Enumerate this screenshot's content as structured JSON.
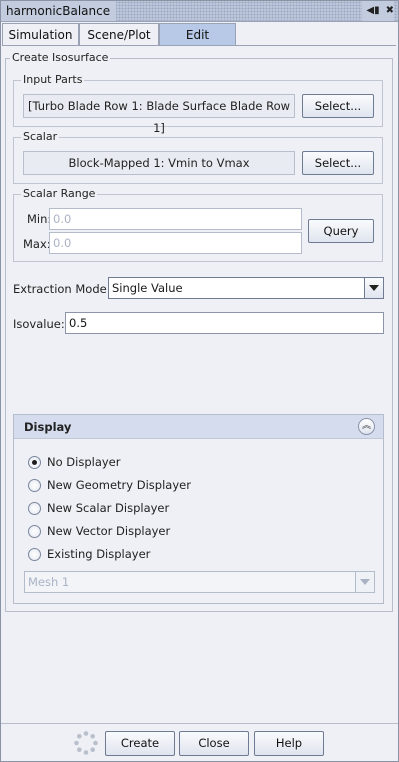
{
  "window": {
    "title": "harmonicBalance"
  },
  "tabs": [
    {
      "label": "Simulation"
    },
    {
      "label": "Scene/Plot"
    },
    {
      "label": "Edit"
    }
  ],
  "active_tab": "Edit",
  "create_isosurface": {
    "legend": "Create Isosurface",
    "input_parts": {
      "legend": "Input Parts",
      "value": "[Turbo Blade Row 1: Blade Surface Blade Row 1]",
      "select_label": "Select..."
    },
    "scalar": {
      "legend": "Scalar",
      "value": "Block-Mapped 1: Vmin to Vmax",
      "select_label": "Select..."
    },
    "scalar_range": {
      "legend": "Scalar Range",
      "min_label": "Min:",
      "min_value": "0.0",
      "max_label": "Max:",
      "max_value": "0.0",
      "query_label": "Query"
    },
    "extraction_mode": {
      "label": "Extraction Mode:",
      "value": "Single Value"
    },
    "isovalue": {
      "label": "Isovalue:",
      "value": "0.5"
    }
  },
  "display": {
    "title": "Display",
    "options": [
      {
        "label": "No Displayer",
        "selected": true
      },
      {
        "label": "New Geometry Displayer",
        "selected": false
      },
      {
        "label": "New Scalar Displayer",
        "selected": false
      },
      {
        "label": "New Vector Displayer",
        "selected": false
      },
      {
        "label": "Existing Displayer",
        "selected": false
      }
    ],
    "existing_value": "Mesh 1"
  },
  "buttons": {
    "create": "Create",
    "close": "Close",
    "help": "Help"
  }
}
